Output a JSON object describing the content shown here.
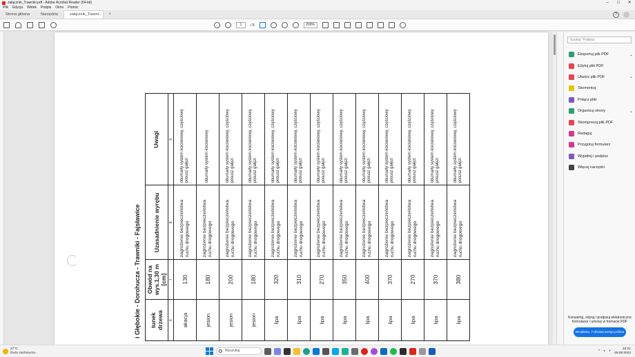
{
  "window": {
    "title": "załącznik_Trawniki.pdf - Adobe Acrobat Reader (64-bit)",
    "controls": [
      "–",
      "□",
      "✕"
    ]
  },
  "menu": [
    "Plik",
    "Edycja",
    "Widok",
    "Podpis",
    "Okno",
    "Pomoc"
  ],
  "tabs": {
    "home": "Strona główna",
    "tools": "Narzędzia",
    "document": "załącznik_Trawni...",
    "close": "×"
  },
  "toolbar": {
    "page_current": "1",
    "page_total": "/ 9",
    "zoom": "200%"
  },
  "document": {
    "title": "i Głębokie - Dorohucza - Trawniki - Fajsławice",
    "headers": {
      "gatunek": "tunek drzewa",
      "obwod": "Obwód na wys.1,30 m [cm]",
      "uzasadnienie": "Uzasadnienie wyrębu",
      "uwagi": "Uwagi"
    },
    "column_numbers": [
      "6",
      "7",
      "8",
      "9"
    ],
    "rows": [
      {
        "gatunek": "akacja",
        "obwod": "130",
        "uzasadnienie": "zagrożenie bezpieczeństwa ruchu drogowego",
        "uwagi": "obumarły system korzeniowy, częściowy posusz gałęzi"
      },
      {
        "gatunek": "jesion",
        "obwod": "180",
        "uzasadnienie": "zagrożenie bezpieczeństwa ruchu drogowego",
        "uwagi": "obumarły system korzeniowy"
      },
      {
        "gatunek": "jesion",
        "obwod": "200",
        "uzasadnienie": "zagrożenie bezpieczeństwa ruchu drogowego",
        "uwagi": "obumarły system korzeniowy, częściowy posusz gałęzi"
      },
      {
        "gatunek": "jesion",
        "obwod": "180",
        "uzasadnienie": "zagrożenie bezpieczeństwa ruchu drogowego",
        "uwagi": "obumarły system korzeniowy, częściowy posusz gałęzi"
      },
      {
        "gatunek": "lipa",
        "obwod": "320",
        "uzasadnienie": "zagrożenie bezpieczeństwa ruchu drogowego",
        "uwagi": "obumarły system korzeniowy, częściowy posusz gałęzi"
      },
      {
        "gatunek": "lipa",
        "obwod": "310",
        "uzasadnienie": "zagrożenie bezpieczeństwa ruchu drogowego",
        "uwagi": "obumarły system korzeniowy, częściowy posusz gałęzi"
      },
      {
        "gatunek": "lipa",
        "obwod": "270",
        "uzasadnienie": "zagrożenie bezpieczeństwa ruchu drogowego",
        "uwagi": "obumarły system korzeniowy, częściowy posusz gałęzi"
      },
      {
        "gatunek": "lipa",
        "obwod": "350",
        "uzasadnienie": "zagrożenie bezpieczeństwa ruchu drogowego",
        "uwagi": "obumarły system korzeniowy, częściowy posusz gałęzi"
      },
      {
        "gatunek": "lipa",
        "obwod": "400",
        "uzasadnienie": "zagrożenie bezpieczeństwa ruchu drogowego",
        "uwagi": "obumarły system korzeniowy, częściowy posusz gałęzi"
      },
      {
        "gatunek": "lipa",
        "obwod": "370",
        "uzasadnienie": "zagrożenie bezpieczeństwa ruchu drogowego",
        "uwagi": "obumarły system korzeniowy, częściowy posusz gałęzi"
      },
      {
        "gatunek": "lipa",
        "obwod": "270",
        "uzasadnienie": "zagrożenie bezpieczeństwa ruchu drogowego",
        "uwagi": "obumarły system korzeniowy, częściowy posusz gałęzi"
      },
      {
        "gatunek": "lipa",
        "obwod": "370",
        "uzasadnienie": "zagrożenie bezpieczeństwa ruchu drogowego",
        "uwagi": "obumarły system korzeniowy, częściowy posusz gałęzi"
      },
      {
        "gatunek": "lipa",
        "obwod": "380",
        "uzasadnienie": "zagrożenie bezpieczeństwa ruchu drogowego",
        "uwagi": "obumarły system korzeniowy, częściowy posusz gałęzi"
      }
    ]
  },
  "sidepanel": {
    "search_placeholder": "Szukaj: Podpisz",
    "tools": [
      {
        "label": "Eksportuj plik PDF",
        "icon": "export-pdf-icon",
        "color": "#2d9d78",
        "chevron": true
      },
      {
        "label": "Edytuj plik PDF",
        "icon": "edit-pdf-icon",
        "color": "#e34850",
        "chevron": false
      },
      {
        "label": "Utwórz plik PDF",
        "icon": "create-pdf-icon",
        "color": "#e34850",
        "chevron": true
      },
      {
        "label": "Skomentuj",
        "icon": "comment-icon",
        "color": "#e8c600",
        "chevron": false
      },
      {
        "label": "Połącz pliki",
        "icon": "combine-icon",
        "color": "#7e57c2",
        "chevron": false
      },
      {
        "label": "Organizuj strony",
        "icon": "organize-icon",
        "color": "#2d9d78",
        "chevron": true
      },
      {
        "label": "Skompresuj plik PDF",
        "icon": "compress-icon",
        "color": "#e34850",
        "chevron": false
      },
      {
        "label": "Redaguj",
        "icon": "redact-icon",
        "color": "#d83790",
        "chevron": false
      },
      {
        "label": "Przygotuj formularz",
        "icon": "form-icon",
        "color": "#d83790",
        "chevron": false
      },
      {
        "label": "Wypełnij i podpisz",
        "icon": "fill-sign-icon",
        "color": "#7e57c2",
        "chevron": false
      },
      {
        "label": "Więcej narzędzi",
        "icon": "more-tools-icon",
        "color": "#444444",
        "chevron": false
      }
    ],
    "promo_text": "Konwertuj, edytuj i podpisuj elektroniczne formularze i umowy w formacie PDF",
    "promo_button": "Bezpłatna, 7-dniowa wersja próbna"
  },
  "taskbar": {
    "weather_temp": "27°C",
    "weather_desc": "Duże zachmurze...",
    "search_placeholder": "Wyszukaj",
    "time": "22:21",
    "date": "26.08.2023"
  },
  "colors": {
    "accent": "#1473e6",
    "pdf_red": "#d9261c"
  }
}
